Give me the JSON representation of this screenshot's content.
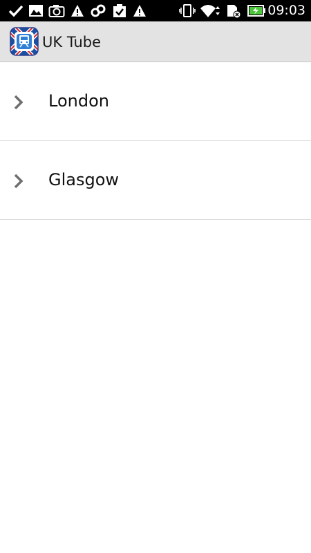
{
  "status_bar": {
    "time": "09:03",
    "icons": [
      "check-icon",
      "image-icon",
      "camera-icon",
      "warning-icon",
      "link-icon",
      "clipboard-check-icon",
      "warning-icon",
      "vibrate-icon",
      "wifi-icon",
      "sd-card-icon",
      "battery-charging-icon"
    ]
  },
  "action_bar": {
    "title": "UK Tube",
    "icon": "tube-train-icon",
    "brand_colors": {
      "blue": "#1b4fa3",
      "red": "#d42a2a",
      "white": "#ffffff"
    }
  },
  "list": {
    "items": [
      {
        "label": "London",
        "icon": "chevron-right-icon"
      },
      {
        "label": "Glasgow",
        "icon": "chevron-right-icon"
      }
    ]
  }
}
